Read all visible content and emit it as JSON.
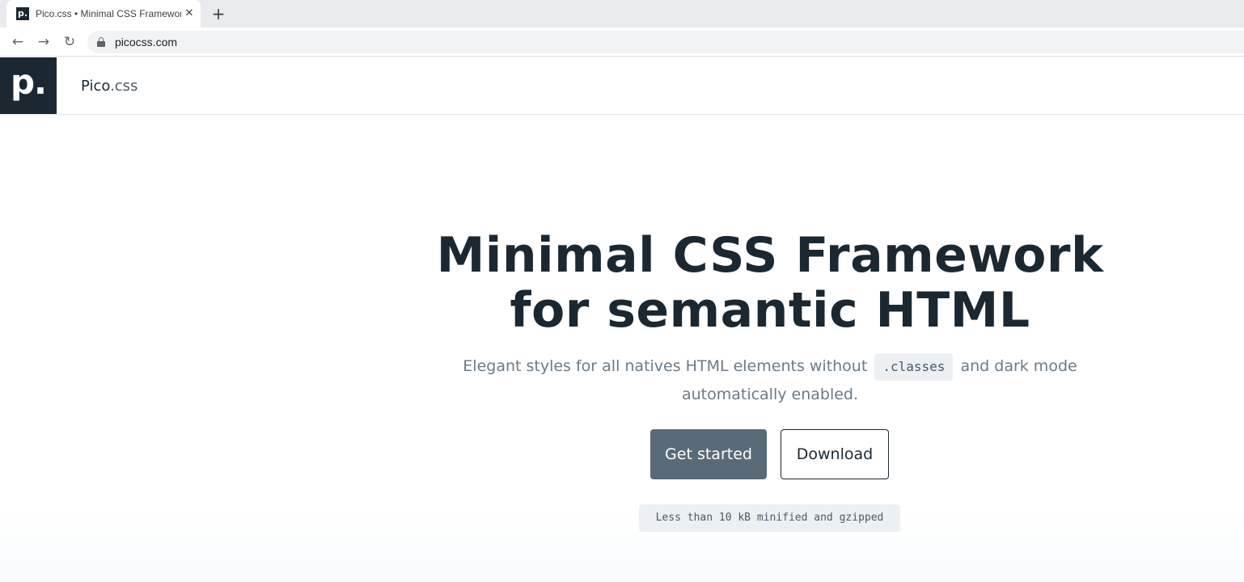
{
  "browser": {
    "tab": {
      "title": "Pico.css • Minimal CSS Framework for semantic HTML",
      "favicon": "p.",
      "close": "✕"
    },
    "new_tab": "+",
    "nav": {
      "back": "←",
      "forward": "→",
      "reload": "↻"
    },
    "url": "picocss.com"
  },
  "header": {
    "logo_text": "p.",
    "brand_main": "Pico",
    "brand_suffix": ".css"
  },
  "hero": {
    "title": "Minimal CSS Framework for semantic HTML",
    "subtitle_before": "Elegant styles for all natives HTML elements without",
    "subtitle_code": ".classes",
    "subtitle_after": "and dark mode automatically enabled.",
    "primary_button": "Get started",
    "secondary_button": "Download",
    "size_note": "Less than 10 kB minified and gzipped"
  },
  "colors": {
    "brand_dark": "#1b2832",
    "primary_button": "#596b78",
    "muted_text": "#6b7a88",
    "code_bg": "#edf0f3"
  }
}
